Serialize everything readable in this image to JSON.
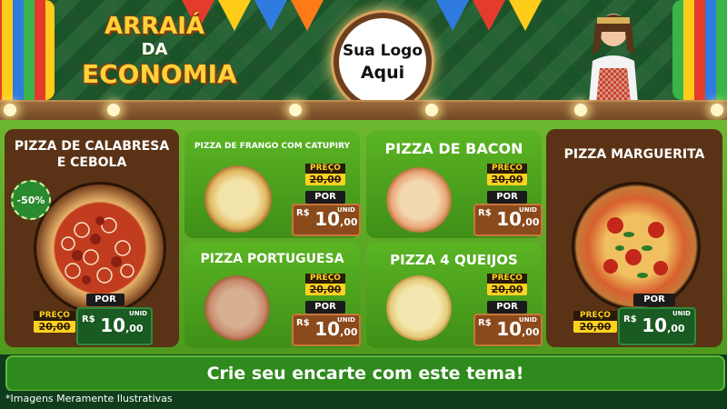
{
  "header": {
    "title_line1": "ARRAIÁ",
    "title_line2": "DA",
    "title_line3": "ECONOMIA",
    "logo_line1": "Sua Logo",
    "logo_line2": "Aqui"
  },
  "labels": {
    "preco": "PREÇO",
    "por": "POR",
    "currency": "R$",
    "unid": "UNID",
    "old_price": "20,00",
    "new_int": "10",
    "new_cents": ",00"
  },
  "products": [
    {
      "name": "PIZZA DE CALABRESA E CEBOLA",
      "discount": "-50%"
    },
    {
      "name": "PIZZA DE FRANGO COM CATUPIRY"
    },
    {
      "name": "PIZZA DE BACON"
    },
    {
      "name": "PIZZA MARGUERITA"
    },
    {
      "name": "PIZZA PORTUGUESA"
    },
    {
      "name": "PIZZA 4 QUEIJOS"
    }
  ],
  "cta": "Crie seu encarte com este tema!",
  "footnote": "*Imagens Meramente Ilustrativas",
  "colors": {
    "brand_green": "#3f8f17",
    "brown": "#5a3316",
    "yellow": "#ffd21f"
  }
}
